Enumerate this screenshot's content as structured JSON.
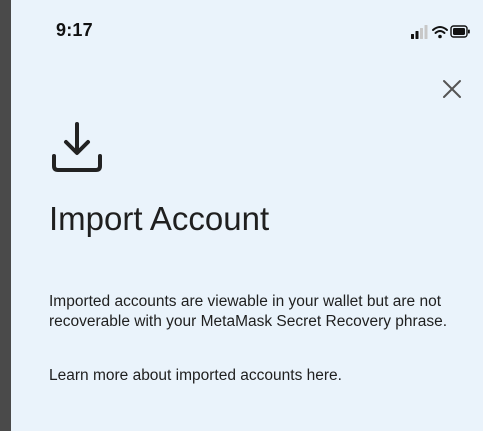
{
  "status_bar": {
    "time": "9:17",
    "icons": [
      "signal-icon",
      "wifi-icon",
      "battery-icon"
    ]
  },
  "header": {
    "close_icon": "close-icon"
  },
  "main": {
    "icon": "import-download-icon",
    "title": "Import Account",
    "description": "Imported accounts are viewable in your wallet but are not recoverable with your MetaMask Secret Recovery phrase.",
    "learn_more": "Learn more about imported accounts here."
  },
  "colors": {
    "background": "#eaf3fb",
    "text": "#1f1f1f",
    "icon": "#222222"
  }
}
